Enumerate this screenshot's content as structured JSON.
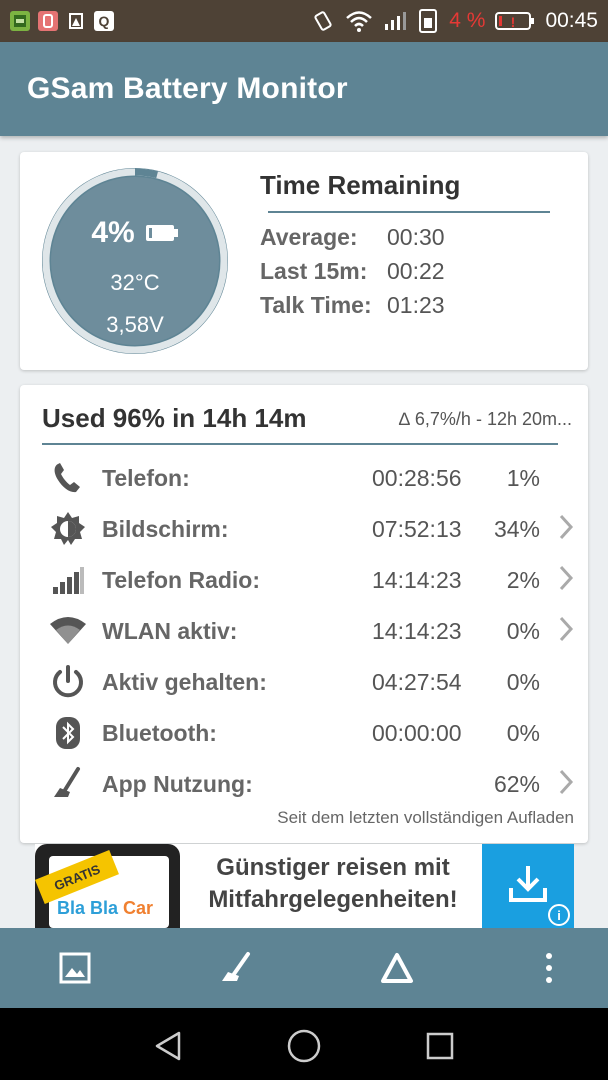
{
  "status_bar": {
    "battery_percent": "4 %",
    "time": "00:45"
  },
  "app": {
    "title": "GSam Battery Monitor"
  },
  "battery": {
    "percent": "4%",
    "percent_value": 4,
    "temperature": "32°C",
    "voltage": "3,58V"
  },
  "time_remaining": {
    "title": "Time Remaining",
    "rows": [
      {
        "label": "Average:",
        "value": "00:30"
      },
      {
        "label": "Last 15m:",
        "value": "00:22"
      },
      {
        "label": "Talk Time:",
        "value": "01:23"
      }
    ]
  },
  "usage": {
    "title": "Used 96% in 14h 14m",
    "rate": "∆ 6,7%/h - 12h 20m...",
    "footer": "Seit dem letzten vollständigen Aufladen",
    "rows": [
      {
        "icon": "phone-icon",
        "label": "Telefon:",
        "time": "00:28:56",
        "percent": "1%"
      },
      {
        "icon": "screen-brightness-icon",
        "label": "Bildschirm:",
        "time": "07:52:13",
        "percent": "34%"
      },
      {
        "icon": "signal-bars-icon",
        "label": "Telefon Radio:",
        "time": "14:14:23",
        "percent": "2%"
      },
      {
        "icon": "wifi-icon",
        "label": "WLAN aktiv:",
        "time": "14:14:23",
        "percent": "0%"
      },
      {
        "icon": "power-icon",
        "label": "Aktiv gehalten:",
        "time": "04:27:54",
        "percent": "0%"
      },
      {
        "icon": "bluetooth-icon",
        "label": "Bluetooth:",
        "time": "00:00:00",
        "percent": "0%"
      },
      {
        "icon": "app-usage-icon",
        "label": "App Nutzung:",
        "time": "",
        "percent": "62%"
      }
    ]
  },
  "ad": {
    "badge": "GRATIS",
    "brand_part1": "Bla Bla ",
    "brand_part2": "Car",
    "line1": "Günstiger reisen mit",
    "line2": "Mitfahrgelegenheiten!"
  },
  "colors": {
    "app_bar": "#5e8494",
    "status_bar": "#4e4236",
    "gauge_fill": "#6e8d9c",
    "gauge_ring": "#dfe6e9",
    "low_battery": "#e53935"
  }
}
